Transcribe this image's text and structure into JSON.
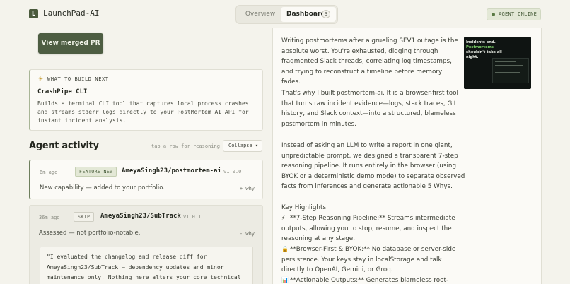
{
  "header": {
    "logo_letter": "L",
    "app_title": "LaunchPad-AI",
    "tabs": [
      {
        "label": "Overview"
      },
      {
        "label": "Dashboard",
        "count": "3"
      }
    ],
    "agent_status": "AGENT ONLINE"
  },
  "left": {
    "merged_button": "View merged PR",
    "build_next": {
      "icon": "lightbulb-icon",
      "label": "WHAT TO BUILD NEXT",
      "title": "CrashPipe CLI",
      "description": "Builds a terminal CLI tool that captures local process crashes and streams stderr logs directly to your PostMortem AI API for instant incident analysis."
    },
    "activity": {
      "title": "Agent activity",
      "hint": "tap a row for reasoning",
      "collapse_label": "Collapse ▾",
      "items": [
        {
          "time": "6m ago",
          "tag": "FEATURE NEW",
          "repo": "AmeyaSingh23/postmortem-ai",
          "version": "v1.0.0",
          "summary": "New capability — added to your portfolio.",
          "why": "+ why"
        },
        {
          "time": "36m ago",
          "tag": "SKIP",
          "repo": "AmeyaSingh23/SubTrack",
          "version": "v1.0.1",
          "summary": "Assessed — not portfolio-notable.",
          "why": "- why",
          "reasoning": "\"I evaluated the changelog and release diff for AmeyaSingh23/SubTrack — dependency updates and minor maintenance only. Nothing here alters your core technical capability, so I left your portfolio untouched.\""
        }
      ]
    }
  },
  "right": {
    "paragraphs": [
      "Writing postmortems after a grueling SEV1 outage is the absolute worst. You're exhausted, digging through fragmented Slack threads, correlating log timestamps, and trying to reconstruct a timeline before memory fades.",
      "That's why I built postmortem-ai. It is a browser-first tool that turns raw incident evidence—logs, stack traces, Git history, and Slack context—into a structured, blameless postmortem in minutes.",
      "Instead of asking an LLM to write a report in one giant, unpredictable prompt, we designed a transparent 7-step reasoning pipeline. It runs entirely in the browser (using BYOK or a deterministic demo mode) to separate observed facts from inferences and generate actionable 5 Whys."
    ],
    "highlights_title": "Key Highlights:",
    "highlights": [
      {
        "icon": "lightning-icon",
        "glyph": "⚡",
        "text": "**7-Step Reasoning Pipeline:** Streams intermediate outputs, allowing you to stop, resume, and inspect the reasoning at any stage."
      },
      {
        "icon": "lock-icon",
        "glyph": "🔒",
        "text": "**Browser-First & BYOK:** No database or server-side persistence. Your keys stay in localStorage and talk directly to OpenAI, Gemini, or Groq."
      },
      {
        "icon": "chart-icon",
        "glyph": "📊",
        "text": "**Actionable Outputs:** Generates blameless root-cause"
      }
    ],
    "thumbnail": {
      "line1": "Incidents end.",
      "line2": "Postmortems",
      "line3": "shouldn't take all",
      "line4": "night."
    }
  },
  "colors": {
    "background": "#f4f3ec",
    "accent": "#4d5d42",
    "card": "#fbfaf6"
  }
}
